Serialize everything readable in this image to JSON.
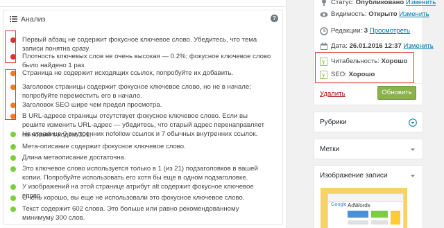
{
  "analysis": {
    "title": "Анализ",
    "help": "?",
    "items": [
      {
        "status": "red",
        "text": "Первый абзац не содержит фокусное ключевое слово. Убедитесь, что тема записи понятна сразу."
      },
      {
        "status": "red",
        "text": "Плотность ключевых слов не очень высокая — 0.2%; фокусное ключевое слово было найдено 1 раз."
      },
      {
        "status": "orange",
        "text": "Страница не содержит исходящих ссылок, попробуйте их добавить."
      },
      {
        "status": "orange",
        "text": "Заголовок страницы содержит фокусное ключевое слово, но не в начале; попробуйте переместить его в начало."
      },
      {
        "status": "orange",
        "text": "Заголовок SEO шире чем предел просмотра."
      },
      {
        "status": "orange",
        "text": "В URL-адресе страницы отсутствует фокусное ключевое слово. Если вы решите изменить URL-адрес — убедитесь, что старый адрес перенаправляет на новый с кодом 301."
      },
      {
        "status": "green",
        "text": "На странице 0 внутренних nofollow ссылок и 7 обычных внутренних ссылок."
      },
      {
        "status": "green",
        "text": "Мета-описание содержит фокусное ключевое слово."
      },
      {
        "status": "green",
        "text": "Длина метаописание достаточна."
      },
      {
        "status": "green",
        "text": "Это ключевое слово используется только в 1 (из 21) подзаголовков в вашей копии. Попробуйте использовать его хотя бы еще в одном подзаголовке."
      },
      {
        "status": "green",
        "text": "У изображений на этой странице атрибут alt содержит фокусное ключевое слово."
      },
      {
        "status": "green",
        "text": "Очень хорошо, вы еще не использовали это фокусное ключевое слово."
      },
      {
        "status": "green",
        "text": "Текст содержит 602 слова. Это больше или равно рекомендованному минимуму 300 слов."
      }
    ]
  },
  "publish": {
    "status_label": "Статус:",
    "status_value": "Опубликовано",
    "status_link": "Изменить",
    "visibility_label": "Видимость:",
    "visibility_value": "Открыто",
    "visibility_link": "Изменить",
    "revisions_label": "Редакции:",
    "revisions_value": "3",
    "revisions_link": "Просмотреть",
    "date_label": "Дата:",
    "date_value": "26.01.2016 12:37",
    "date_link": "Изменить",
    "readability_label": "Читабельность:",
    "readability_value": "Хорошо",
    "seo_label": "SEO:",
    "seo_value": "Хорошо",
    "delete_link": "Удалить",
    "update_button": "Обновить"
  },
  "boxes": {
    "rubrics": "Рубрики",
    "tags": "Метки",
    "featured_image": "Изображение записи",
    "image_google": "Google",
    "image_adwords": "AdWords"
  },
  "colors": {
    "red": "#dc3232",
    "orange": "#ee7c1b",
    "green": "#7ad03a",
    "highlight": "#e53935",
    "link": "#0073aa"
  }
}
